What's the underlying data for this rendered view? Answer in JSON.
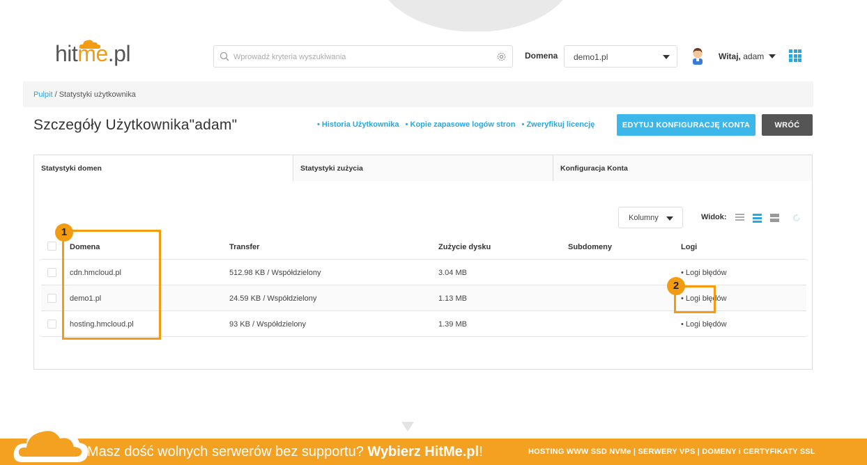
{
  "header": {
    "logo": {
      "hit": "hit",
      "me": "me",
      "pl": ".pl"
    },
    "search_placeholder": "Wprowadź kryteria wyszukiwania",
    "domain_label": "Domena",
    "domain_value": "demo1.pl",
    "welcome_bold": "Witaj,",
    "welcome_user": "adam"
  },
  "breadcrumb": {
    "root": "Pulpit",
    "current": "/ Statystyki użytkownika"
  },
  "page_title": "Szczegóły Użytkownika\"adam\"",
  "quick_links": [
    "• Historia Użytkownika",
    "• Kopie zapasowe logów stron",
    "• Zweryfikuj licencję"
  ],
  "buttons": {
    "edit": "EDYTUJ KONFIGURACJĘ KONTA",
    "back": "WRÓĆ"
  },
  "tabs": [
    "Statystyki domen",
    "Statystyki zużycia",
    "Konfiguracja Konta"
  ],
  "toolbar": {
    "columns": "Kolumny",
    "view_label": "Widok:"
  },
  "table": {
    "headers": [
      "Domena",
      "Transfer",
      "Zużycie dysku",
      "Subdomeny",
      "Logi"
    ],
    "rows": [
      {
        "domain": "cdn.hmcloud.pl",
        "transfer": "512.98 KB / Współdzielony",
        "disk": "3.04 MB",
        "subdomains": "",
        "logs": "• Logi błędów"
      },
      {
        "domain": "demo1.pl",
        "transfer": "24.59 KB / Współdzielony",
        "disk": "1.13 MB",
        "subdomains": "",
        "logs": "• Logi błędów"
      },
      {
        "domain": "hosting.hmcloud.pl",
        "transfer": "93 KB / Współdzielony",
        "disk": "1.39 MB",
        "subdomains": "",
        "logs": "• Logi błędów"
      }
    ]
  },
  "annotations": {
    "badge1": "1",
    "badge2": "2"
  },
  "footer": {
    "text_plain": "Masz dość wolnych serwerów bez supportu?",
    "text_bold": "Wybierz HitMe.pl",
    "text_end": "!",
    "right": "HOSTING WWW SSD NVMe | SERWERY VPS | DOMENY i CERTYFIKATY SSL"
  },
  "colors": {
    "accent": "#29a8e0",
    "brand_orange": "#f39c12",
    "edit_button": "#3bb7ea",
    "back_button": "#555555"
  },
  "icons": [
    "search-icon",
    "gear-icon",
    "chevron-down-icon",
    "avatar",
    "apps-grid-icon",
    "view-list-icon",
    "refresh-icon",
    "cloud-icon"
  ]
}
